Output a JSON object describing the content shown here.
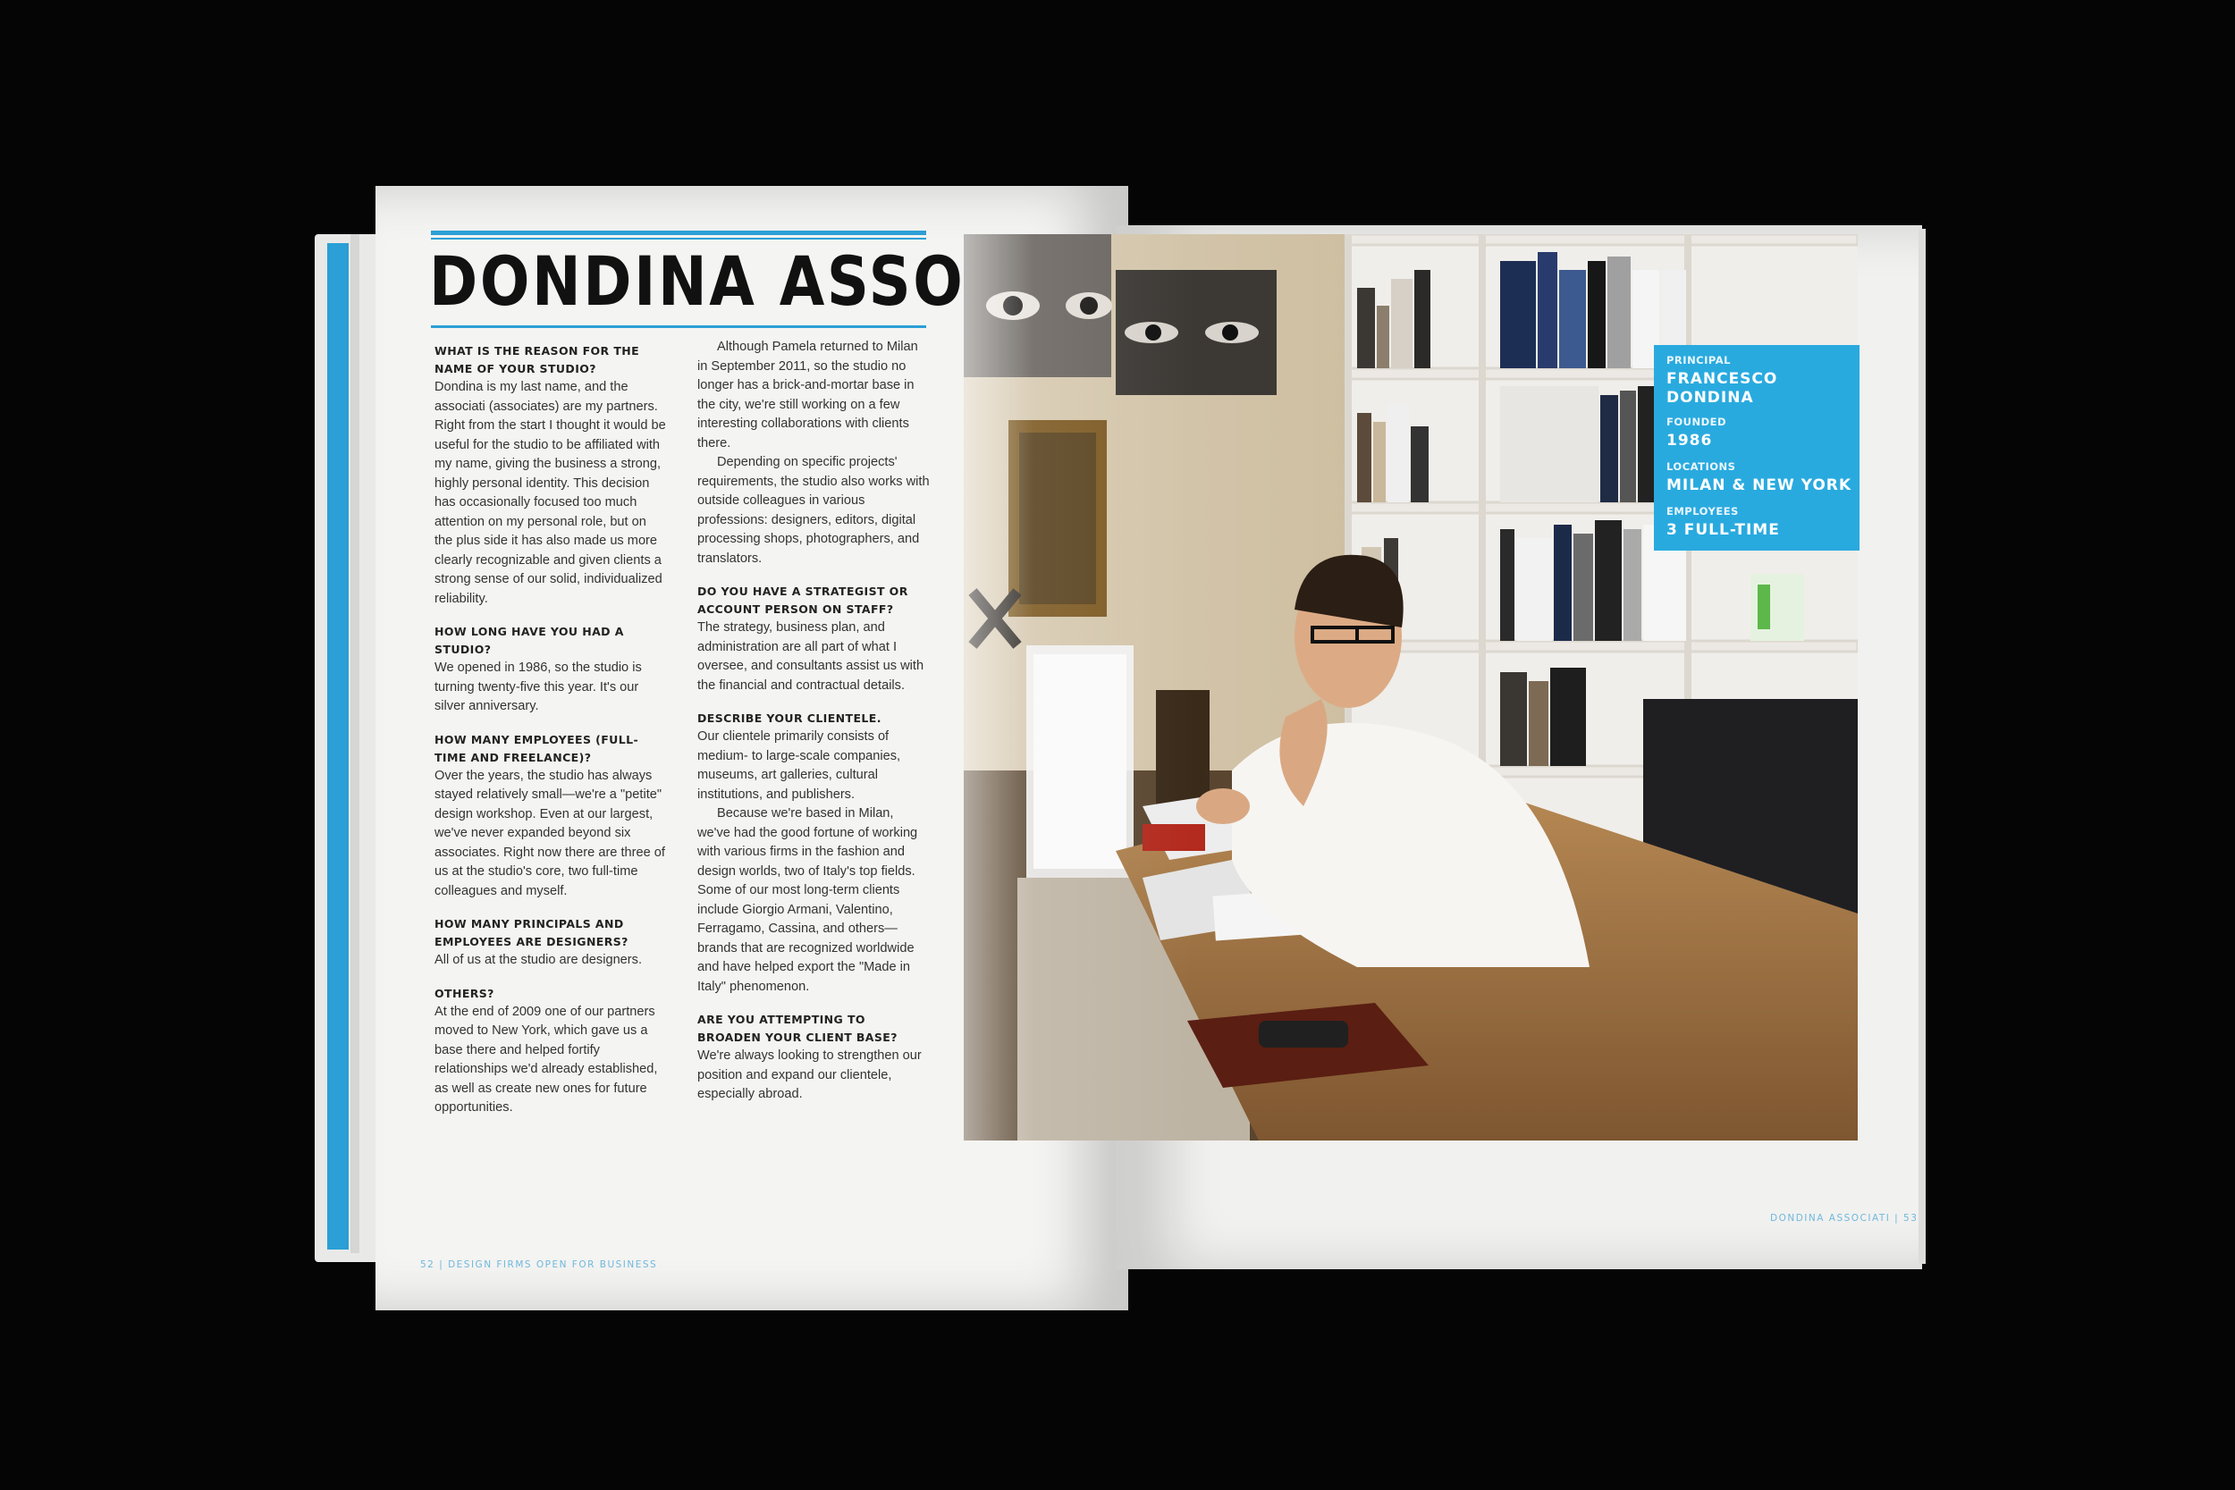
{
  "title": "DONDINA ASSOCIATI",
  "column1": {
    "q1": "WHAT IS THE REASON FOR THE NAME OF YOUR STUDIO?",
    "a1": "Dondina is my last name, and the associati (associates) are my partners. Right from the start I thought it would be useful for the studio to be affiliated with my name, giving the business a strong, highly personal identity. This decision has occasionally focused too much attention on my personal role, but on the plus side it has also made us more clearly recognizable and given clients a strong sense of our solid, individualized reliability.",
    "q2": "HOW LONG HAVE YOU HAD A STUDIO?",
    "a2": "We opened in 1986, so the studio is turning twenty-five this year. It's our silver anniversary.",
    "q3": "HOW MANY EMPLOYEES (FULL-TIME AND FREELANCE)?",
    "a3": "Over the years, the studio has always stayed relatively small—we're a \"petite\" design workshop. Even at our largest, we've never expanded beyond six associates. Right now there are three of us at the studio's core, two full-time colleagues and myself.",
    "q4": "HOW MANY PRINCIPALS AND EMPLOYEES ARE DESIGNERS?",
    "a4": "All of us at the studio are designers.",
    "q5": "OTHERS?",
    "a5": "At the end of 2009 one of our partners moved to New York, which gave us a base there and helped fortify relationships we'd already established, as well as create new ones for future opportunities."
  },
  "column2": {
    "p1": "Although Pamela returned to Milan in September 2011, so the studio no longer has a brick-and-mortar base in the city, we're still working on a few interesting collaborations with clients there.",
    "p2": "Depending on specific projects' requirements, the studio also works with outside colleagues in various professions: designers, editors, digital processing shops, photographers, and translators.",
    "q6": "DO YOU HAVE A STRATEGIST OR ACCOUNT PERSON ON STAFF?",
    "a6": "The strategy, business plan, and administration are all part of what I oversee, and consultants assist us with the financial and contractual details.",
    "q7": "DESCRIBE YOUR CLIENTELE.",
    "a7": "Our clientele primarily consists of medium- to large-scale companies, museums, art galleries, cultural institutions, and publishers.",
    "a7b": "Because we're based in Milan, we've had the good fortune of working with various firms in the fashion and design worlds, two of Italy's top fields. Some of our most long-term clients include Giorgio Armani, Valentino, Ferragamo, Cassina, and others—brands that are recognized worldwide and have helped export the \"Made in Italy\" phenomenon.",
    "q8": "ARE YOU ATTEMPTING TO BROADEN YOUR CLIENT BASE?",
    "a8": "We're always looking to strengthen our position and expand our clientele, especially abroad."
  },
  "infobox": {
    "principal_label": "PRINCIPAL",
    "principal_line1": "FRANCESCO",
    "principal_line2": "DONDINA",
    "founded_label": "FOUNDED",
    "founded": "1986",
    "locations_label": "LOCATIONS",
    "locations": "MILAN & NEW YORK",
    "employees_label": "EMPLOYEES",
    "employees": "3 FULL-TIME"
  },
  "footer": {
    "left": "52 | DESIGN FIRMS OPEN FOR BUSINESS",
    "right": "DONDINA ASSOCIATI | 53"
  },
  "colors": {
    "accent": "#2b9fd6",
    "background": "#050505",
    "page": "#f4f4f2"
  }
}
